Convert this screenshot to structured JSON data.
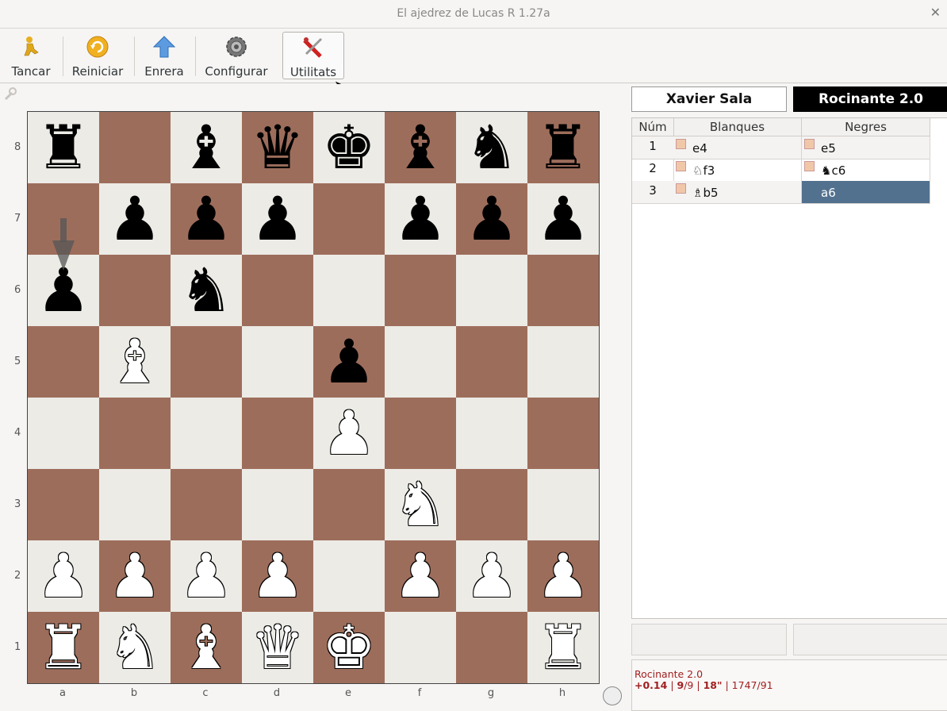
{
  "window": {
    "title": "El ajedrez de Lucas R 1.27a",
    "close_icon": "close-icon"
  },
  "toolbar": {
    "buttons": [
      {
        "label": "Tancar",
        "icon": "person-icon"
      },
      {
        "label": "Reiniciar",
        "icon": "refresh-icon"
      },
      {
        "label": "Enrera",
        "icon": "up-arrow-icon"
      },
      {
        "label": "Configurar",
        "icon": "gear-icon"
      },
      {
        "label": "Utilitats",
        "icon": "tools-icon"
      }
    ]
  },
  "board": {
    "ranks": [
      "8",
      "7",
      "6",
      "5",
      "4",
      "3",
      "2",
      "1"
    ],
    "files": [
      "a",
      "b",
      "c",
      "d",
      "e",
      "f",
      "g",
      "h"
    ],
    "position": [
      [
        "r",
        "",
        "b",
        "q",
        "k",
        "b",
        "n",
        "r"
      ],
      [
        "",
        "p",
        "p",
        "p",
        "",
        "p",
        "p",
        "p"
      ],
      [
        "p",
        "",
        "n",
        "",
        "",
        "",
        "",
        ""
      ],
      [
        "",
        "B",
        "",
        "",
        "p",
        "",
        "",
        ""
      ],
      [
        "",
        "",
        "",
        "",
        "P",
        "",
        "",
        ""
      ],
      [
        "",
        "",
        "",
        "",
        "",
        "N",
        "",
        ""
      ],
      [
        "P",
        "P",
        "P",
        "P",
        "",
        "P",
        "P",
        "P"
      ],
      [
        "R",
        "N",
        "B",
        "Q",
        "K",
        "",
        "",
        "R"
      ]
    ]
  },
  "players": {
    "white": "Xavier Sala",
    "black": "Rocinante 2.0"
  },
  "moves_table": {
    "headers": [
      "Núm",
      "Blanques",
      "Negres"
    ],
    "rows": [
      {
        "num": "1",
        "white": "e4",
        "black": "e5"
      },
      {
        "num": "2",
        "white": "♘f3",
        "black": "♞c6"
      },
      {
        "num": "3",
        "white": "♗b5",
        "black": "a6"
      }
    ]
  },
  "engine_info": {
    "name": "Rocinante 2.0",
    "score": "+0.14",
    "depth": "9",
    "seldepth": "/9",
    "time": "18\"",
    "nodes": "| 1747/91",
    "sep": "|"
  }
}
